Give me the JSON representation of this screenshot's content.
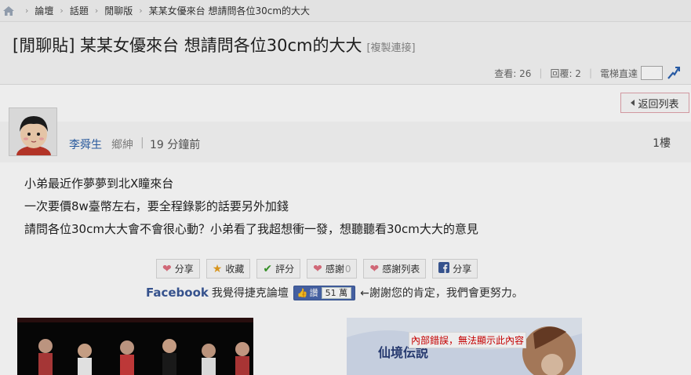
{
  "breadcrumb": {
    "items": [
      "論壇",
      "話題",
      "閒聊版",
      "某某女優來台 想請問各位30cm的大大"
    ],
    "separator": "›"
  },
  "thread": {
    "title": "[閒聊貼] 某某女優來台 想請問各位30cm的大大",
    "copy_link": "[複製連接]",
    "views_label": "查看: 26",
    "replies_label": "回覆: 2",
    "jump_label": "電梯直達",
    "jump_value": ""
  },
  "back_button": "返回列表",
  "post": {
    "author": "李舜生",
    "rank": "鄉紳",
    "separator": "|",
    "time": "19 分鐘前",
    "floor": "1樓",
    "lines": [
      "小弟最近作夢夢到北X瞳來台",
      "一次要價8w臺幣左右，要全程錄影的話要另外加錢",
      "請問各位30cm大大會不會很心動？小弟看了我超想衝一發，想聽聽看30cm大大的意見"
    ]
  },
  "actions": [
    {
      "label": "分享",
      "icon": "heart-icon"
    },
    {
      "label": "收藏",
      "icon": "star-icon"
    },
    {
      "label": "評分",
      "icon": "checkmark-icon"
    },
    {
      "label": "感謝",
      "icon": "heart-icon",
      "count": "0"
    },
    {
      "label": "感謝列表",
      "icon": "heart-icon"
    },
    {
      "label": "分享",
      "icon": "facebook-icon"
    }
  ],
  "facebook": {
    "brand": "Facebook",
    "text": "我覺得捷克論壇",
    "like_label": "讚",
    "like_count": "51 萬",
    "thanks": "←謝謝您的肯定，我們會更努力。"
  },
  "ads": {
    "error_text": "內部錯誤，無法顯示此內容",
    "ad2_text": "仙境伝説"
  },
  "colors": {
    "link_blue": "#2a5fa8",
    "facebook_blue": "#3b5998",
    "error_red": "#d40000",
    "heart_pink": "#e07080",
    "star_orange": "#e8a020",
    "check_green": "#3a9a2a"
  }
}
